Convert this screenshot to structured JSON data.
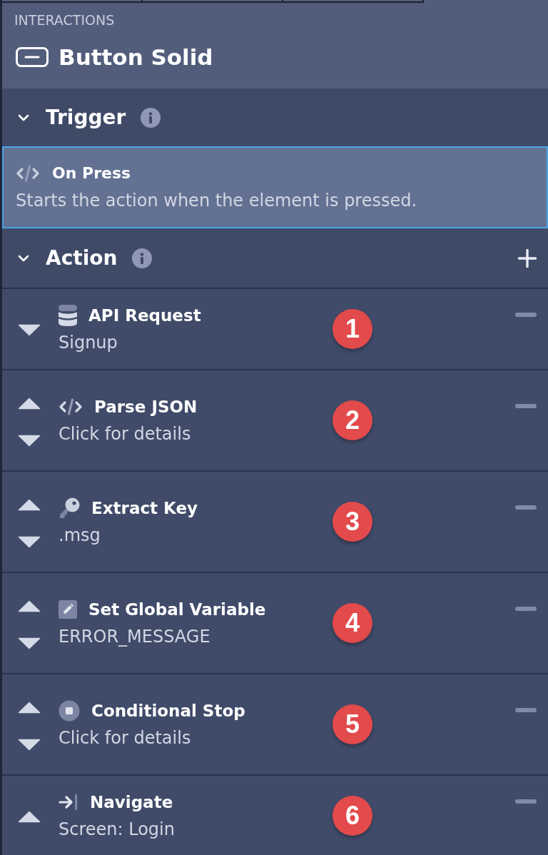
{
  "panel": {
    "section_label": "INTERACTIONS",
    "component_title": "Button Solid"
  },
  "trigger": {
    "title": "Trigger",
    "expanded": true,
    "event": {
      "name": "On Press",
      "description": "Starts the action when the element is pressed.",
      "selected": true
    }
  },
  "action": {
    "title": "Action",
    "expanded": true,
    "steps": [
      {
        "kind": "request",
        "name": "API Request",
        "detail": "Signup",
        "can_move_up": false,
        "can_move_down": true,
        "badge": "1"
      },
      {
        "kind": "parse",
        "name": "Parse JSON",
        "detail": "Click for details",
        "can_move_up": true,
        "can_move_down": true,
        "badge": "2"
      },
      {
        "kind": "extract",
        "name": "Extract Key",
        "detail": ".msg",
        "can_move_up": true,
        "can_move_down": true,
        "badge": "3"
      },
      {
        "kind": "variable",
        "name": "Set Global Variable",
        "detail": "ERROR_MESSAGE",
        "can_move_up": true,
        "can_move_down": true,
        "badge": "4"
      },
      {
        "kind": "stop",
        "name": "Conditional Stop",
        "detail": "Click for details",
        "can_move_up": true,
        "can_move_down": true,
        "badge": "5"
      },
      {
        "kind": "navigate",
        "name": "Navigate",
        "detail": "Screen: Login",
        "can_move_up": true,
        "can_move_down": false,
        "badge": "6"
      }
    ]
  }
}
